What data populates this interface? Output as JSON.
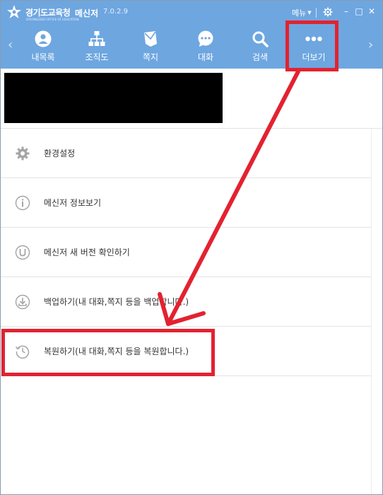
{
  "titlebar": {
    "org_name": "경기도교육청",
    "org_sub": "GYEONGGIDO OFFICE OF EDUCATION",
    "app_name": "메신저",
    "version": "7.0.2.9",
    "menu_label": "메뉴",
    "minimize_glyph": "–",
    "maximize_glyph": "□",
    "close_glyph": "✕"
  },
  "nav": {
    "prev_glyph": "‹",
    "next_glyph": "›",
    "items": [
      {
        "label": "내목록",
        "icon": "person-icon"
      },
      {
        "label": "조직도",
        "icon": "org-chart-icon"
      },
      {
        "label": "쪽지",
        "icon": "note-icon"
      },
      {
        "label": "대화",
        "icon": "chat-icon"
      },
      {
        "label": "검색",
        "icon": "search-icon"
      },
      {
        "label": "더보기",
        "icon": "more-icon"
      }
    ],
    "active_index": 5
  },
  "menu_items": [
    {
      "label": "환경설정",
      "icon": "gear-icon"
    },
    {
      "label": "메신저 정보보기",
      "icon": "info-icon"
    },
    {
      "label": "메신저 새 버전 확인하기",
      "icon": "update-icon"
    },
    {
      "label": "백업하기(내 대화,쪽지 등을 백업합니다.)",
      "icon": "download-icon"
    },
    {
      "label": "복원하기(내 대화,쪽지 등을 복원합니다.)",
      "icon": "restore-icon"
    }
  ],
  "colors": {
    "header_blue": "#6ea6e0",
    "annotation_red": "#e32230"
  }
}
